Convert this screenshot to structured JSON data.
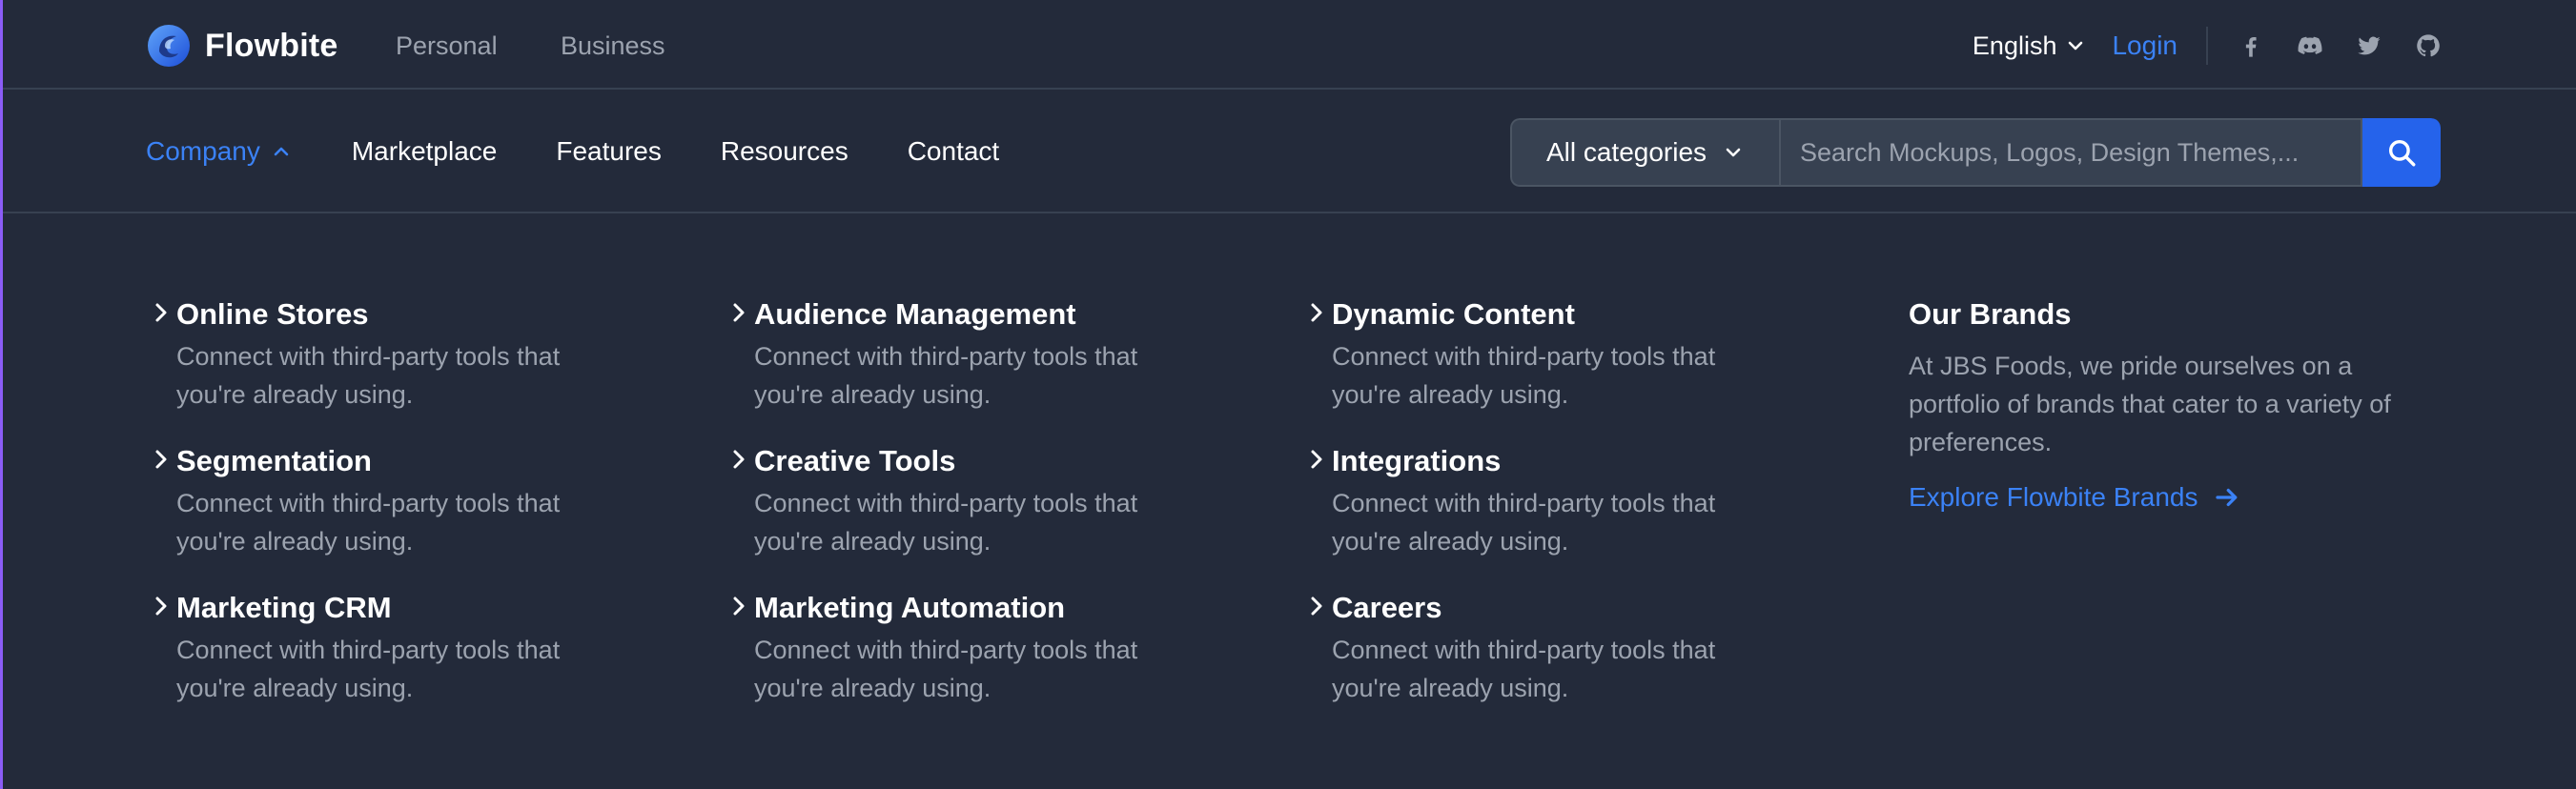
{
  "topbar": {
    "brand_name": "Flowbite",
    "links": [
      {
        "label": "Personal"
      },
      {
        "label": "Business"
      }
    ],
    "language": "English",
    "login_label": "Login",
    "social_icons": [
      "facebook-icon",
      "discord-icon",
      "twitter-icon",
      "github-icon"
    ]
  },
  "nav": {
    "items": [
      {
        "label": "Company",
        "active": true
      },
      {
        "label": "Marketplace"
      },
      {
        "label": "Features"
      },
      {
        "label": "Resources"
      },
      {
        "label": "Contact"
      }
    ]
  },
  "search": {
    "category_label": "All categories",
    "placeholder": "Search Mockups, Logos, Design Themes,...",
    "value": ""
  },
  "menu": {
    "columns": [
      [
        {
          "title": "Online Stores",
          "desc1": "Connect with third-party tools that",
          "desc2": "you're already using."
        },
        {
          "title": "Segmentation",
          "desc1": "Connect with third-party tools that",
          "desc2": "you're already using."
        },
        {
          "title": "Marketing CRM",
          "desc1": "Connect with third-party tools that",
          "desc2": "you're already using."
        }
      ],
      [
        {
          "title": "Audience Management",
          "desc1": "Connect with third-party tools that",
          "desc2": "you're already using."
        },
        {
          "title": "Creative Tools",
          "desc1": "Connect with third-party tools that",
          "desc2": "you're already using."
        },
        {
          "title": "Marketing Automation",
          "desc1": "Connect with third-party tools that",
          "desc2": "you're already using."
        }
      ],
      [
        {
          "title": "Dynamic Content",
          "desc1": "Connect with third-party tools that",
          "desc2": "you're already using."
        },
        {
          "title": "Integrations",
          "desc1": "Connect with third-party tools that",
          "desc2": "you're already using."
        },
        {
          "title": "Careers",
          "desc1": "Connect with third-party tools that",
          "desc2": "you're already using."
        }
      ]
    ]
  },
  "brands": {
    "title": "Our Brands",
    "text1": "At JBS Foods, we pride ourselves on a",
    "text2": "portfolio of brands that cater to a variety of",
    "text3": "preferences.",
    "link_label": "Explore Flowbite Brands"
  },
  "colors": {
    "background": "#232a3a",
    "accent": "#3b82f6",
    "search_button": "#2563eb",
    "muted_text": "#9ca3af"
  }
}
